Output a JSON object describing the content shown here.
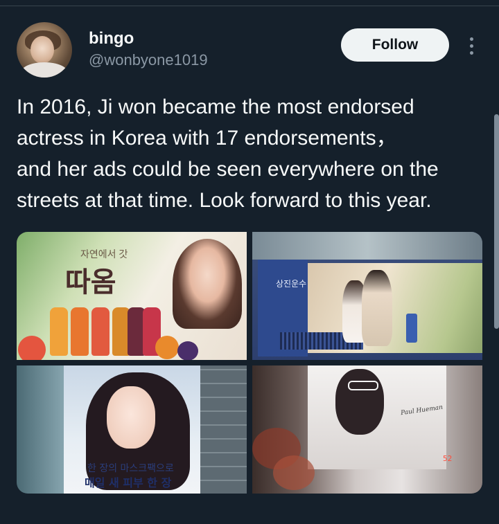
{
  "author": {
    "display_name": "bingo",
    "handle": "@wonbyone1019"
  },
  "actions": {
    "follow_label": "Follow"
  },
  "tweet": {
    "text_lines": [
      "In 2016, Ji won became the most endorsed",
      "actress in Korea with 17 endorsements，",
      "and her ads could be seen everywhere on the",
      "streets at that time. Look forward to this year."
    ]
  },
  "media": {
    "image1": {
      "header_text": "자연에서 갓",
      "brand_text": "따옴"
    },
    "image2": {
      "sign_text": "상진운수"
    },
    "image3": {
      "line1": "한 장의 마스크팩으로",
      "line2": "매일 새 피부 한 장"
    },
    "image4": {
      "logo_text": "Paul Hueman",
      "led_text": "52"
    }
  },
  "colors": {
    "background": "#15202b",
    "text_primary": "#f7f9f9",
    "text_secondary": "#8b98a5",
    "follow_bg": "#eff3f4"
  }
}
